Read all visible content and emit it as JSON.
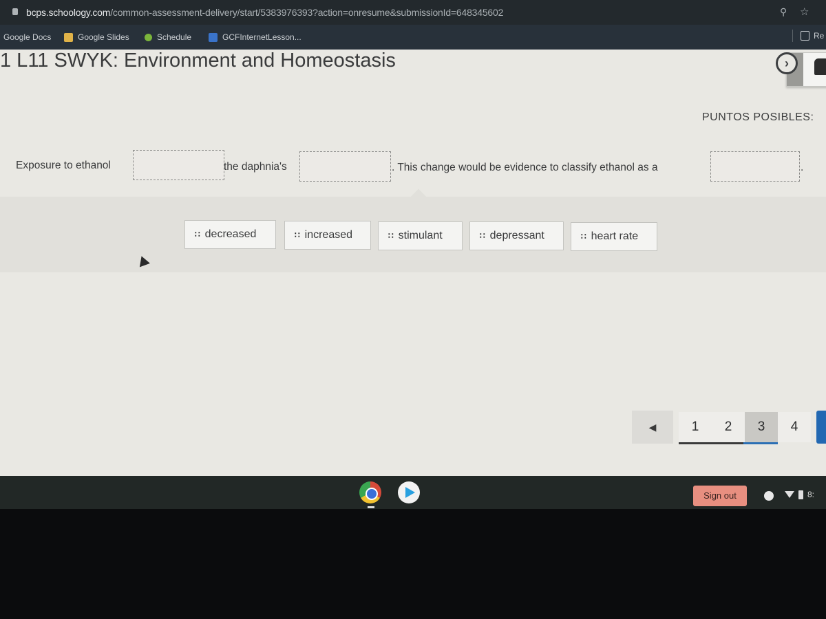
{
  "browser": {
    "url_host": "bcps.schoology.com",
    "url_path": "/common-assessment-delivery/start/5383976393?action=onresume&submissionId=648345602",
    "bookmarks": [
      {
        "label": "Google Docs",
        "icon": "none"
      },
      {
        "label": "Google Slides",
        "icon": "slides-icon"
      },
      {
        "label": "Schedule",
        "icon": "schedule-icon"
      },
      {
        "label": "GCFInternetLesson...",
        "icon": "doc-icon"
      }
    ],
    "reading_list_label": "Re"
  },
  "page": {
    "title": "1 L11 SWYK: Environment and Homeostasis",
    "next_glyph": "›",
    "points_label": "PUNTOS POSIBLES:",
    "sentence": {
      "part1": "Exposure to ethanol",
      "part2": "the daphnia's",
      "part3": ". This change would be evidence to classify ethanol as a",
      "part4": "."
    },
    "drop_zones": [
      "",
      "",
      ""
    ],
    "word_bank": [
      {
        "label": "decreased"
      },
      {
        "label": "increased"
      },
      {
        "label": "stimulant"
      },
      {
        "label": "depressant"
      },
      {
        "label": "heart rate"
      }
    ],
    "grip_glyph": "∷",
    "pagination": {
      "prev_glyph": "◀",
      "pages": [
        "1",
        "2",
        "3",
        "4"
      ],
      "current_page": "3"
    }
  },
  "shelf": {
    "apps": [
      "Chrome",
      "Play Store"
    ],
    "sign_out_label": "Sign out",
    "clock_partial": "8:"
  },
  "colors": {
    "accent_blue": "#2268b2",
    "sign_out_bg": "#e88f80"
  }
}
